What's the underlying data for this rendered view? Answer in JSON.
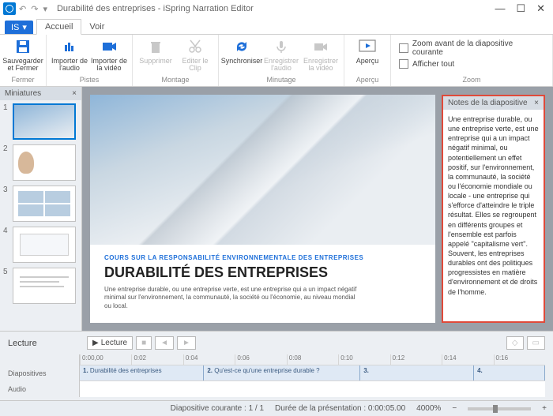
{
  "window": {
    "title": "Durabilité des entreprises - iSpring Narration Editor"
  },
  "tabs": {
    "app_label": "IS",
    "home": "Accueil",
    "view": "Voir"
  },
  "ribbon": {
    "close": {
      "save_close": "Sauvegarder et Fermer",
      "label": "Fermer"
    },
    "tracks": {
      "import_audio": "Importer de l'audio",
      "import_video": "Importer de la vidéo",
      "label": "Pistes"
    },
    "editing": {
      "delete": "Supprimer",
      "edit_clip": "Editer le Clip",
      "label": "Montage"
    },
    "timing": {
      "sync": "Synchroniser",
      "rec_audio": "Enregistrer l'audio",
      "rec_video": "Enregistrer la vidéo",
      "label": "Minutage"
    },
    "preview": {
      "preview": "Aperçu",
      "label": "Aperçu"
    },
    "zoom": {
      "fit": "Zoom avant de la diapositive courante",
      "show_all": "Afficher tout",
      "label": "Zoom"
    }
  },
  "thumbnails": {
    "header": "Miniatures",
    "items": [
      "1",
      "2",
      "3",
      "4",
      "5"
    ]
  },
  "slide": {
    "eyebrow": "COURS SUR LA RESPONSABILITÉ ENVIRONNEMENTALE DES ENTREPRISES",
    "headline": "DURABILITÉ DES ENTREPRISES",
    "body": "Une entreprise durable, ou une entreprise verte, est une entreprise qui a un impact négatif minimal sur l'environnement, la communauté, la société ou l'économie, au niveau mondial ou local."
  },
  "notes": {
    "header": "Notes de la diapositive",
    "text": "Une entreprise durable, ou une entreprise verte, est une entreprise qui a un impact négatif minimal, ou potentiellement un effet positif, sur l'environnement, la communauté, la société ou l'économie mondiale ou locale - une entreprise qui s'efforce d'atteindre le triple résultat. Elles se regroupent en différents groupes et l'ensemble est parfois appelé \"capitalisme vert\". Souvent, les entreprises durables ont des politiques progressistes en matière d'environnement et de droits de l'homme."
  },
  "timeline": {
    "playback_label": "Lecture",
    "play_btn": "Lecture",
    "ruler": [
      "0:00,00",
      "0:02",
      "0:04",
      "0:06",
      "0:08",
      "0:10",
      "0:12",
      "0:14",
      "0:16"
    ],
    "track_slides": "Diapositives",
    "track_audio": "Audio",
    "clips": [
      {
        "n": "1.",
        "t": "Durabilité des entreprises"
      },
      {
        "n": "2.",
        "t": "Qu'est-ce qu'une entreprise durable ?"
      },
      {
        "n": "3.",
        "t": ""
      },
      {
        "n": "4.",
        "t": ""
      }
    ]
  },
  "status": {
    "current": "Diapositive courante : 1 / 1",
    "duration": "Durée de la présentation : 0:00:05.00",
    "zoom": "4000%"
  }
}
